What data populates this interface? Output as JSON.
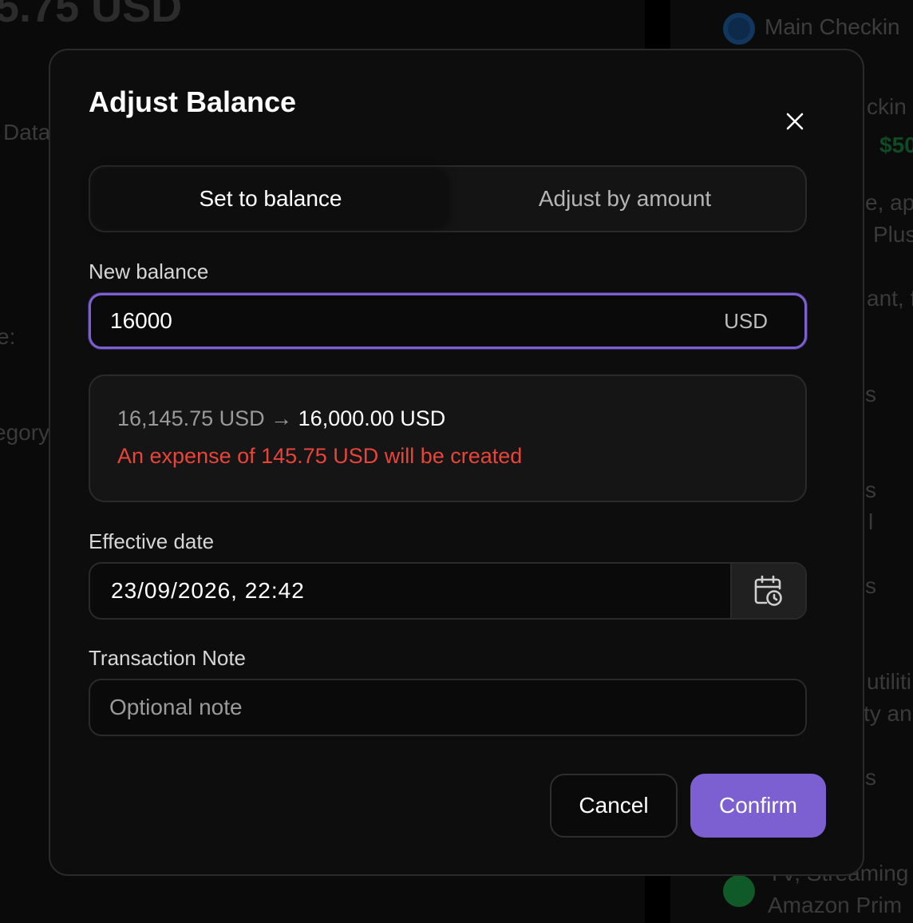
{
  "background": {
    "amount_fragment": "5.75 USD",
    "left_fragments": [
      "Data",
      "e:",
      "egory"
    ],
    "account_name": "Main Checkin",
    "right_fragments": [
      "ckin",
      "$50",
      "e, app",
      "Plus",
      "ant, f",
      "s",
      "s",
      "l",
      "s",
      "utiliti",
      "ty an",
      "s",
      "TV, Streaming",
      "Amazon Prim"
    ]
  },
  "modal": {
    "title": "Adjust Balance",
    "tabs": [
      {
        "label": "Set to balance",
        "active": true
      },
      {
        "label": "Adjust by amount",
        "active": false
      }
    ],
    "new_balance": {
      "label": "New balance",
      "value": "16000",
      "unit": "USD"
    },
    "preview": {
      "from": "16,145.75 USD",
      "arrow": "→",
      "to": "16,000.00 USD",
      "message": "An expense of 145.75 USD will be created"
    },
    "effective_date": {
      "label": "Effective date",
      "value": "23/09/2026, 22:42",
      "icon": "calendar-clock-icon"
    },
    "note": {
      "label": "Transaction Note",
      "placeholder": "Optional note"
    },
    "buttons": {
      "cancel": "Cancel",
      "confirm": "Confirm"
    }
  },
  "colors": {
    "accent": "#7c5fd0",
    "warning": "#e8443a",
    "background": "#0d0d0d"
  }
}
